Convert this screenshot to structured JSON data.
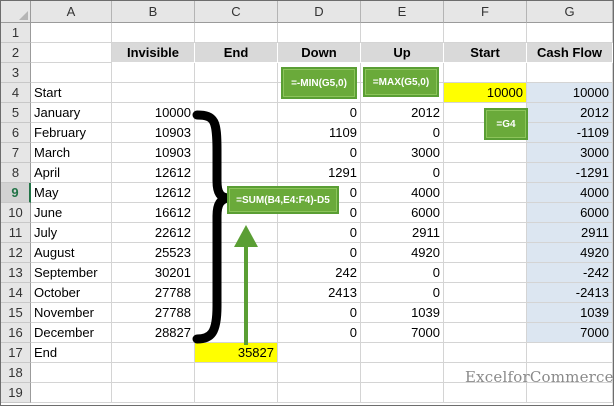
{
  "columns": [
    "A",
    "B",
    "C",
    "D",
    "E",
    "F",
    "G"
  ],
  "rows": [
    "1",
    "2",
    "3",
    "4",
    "5",
    "6",
    "7",
    "8",
    "9",
    "10",
    "11",
    "12",
    "13",
    "14",
    "15",
    "16",
    "17",
    "18",
    "19"
  ],
  "selected_row": "9",
  "headers": {
    "invisible": "Invisible",
    "end": "End",
    "down": "Down",
    "up": "Up",
    "start": "Start",
    "cash_flow": "Cash Flow"
  },
  "start_row": {
    "label": "Start",
    "start_value": "10000",
    "cash_flow": "10000"
  },
  "months": [
    {
      "month": "January",
      "invisible": "10000",
      "down": "0",
      "up": "2012",
      "cash_flow": "2012"
    },
    {
      "month": "February",
      "invisible": "10903",
      "down": "1109",
      "up": "0",
      "cash_flow": "-1109"
    },
    {
      "month": "March",
      "invisible": "10903",
      "down": "0",
      "up": "3000",
      "cash_flow": "3000"
    },
    {
      "month": "April",
      "invisible": "12612",
      "down": "1291",
      "up": "0",
      "cash_flow": "-1291"
    },
    {
      "month": "May",
      "invisible": "12612",
      "down": "0",
      "up": "4000",
      "cash_flow": "4000"
    },
    {
      "month": "June",
      "invisible": "16612",
      "down": "0",
      "up": "6000",
      "cash_flow": "6000"
    },
    {
      "month": "July",
      "invisible": "22612",
      "down": "0",
      "up": "2911",
      "cash_flow": "2911"
    },
    {
      "month": "August",
      "invisible": "25523",
      "down": "0",
      "up": "4920",
      "cash_flow": "4920"
    },
    {
      "month": "September",
      "invisible": "30201",
      "down": "242",
      "up": "0",
      "cash_flow": "-242"
    },
    {
      "month": "October",
      "invisible": "27788",
      "down": "2413",
      "up": "0",
      "cash_flow": "-2413"
    },
    {
      "month": "November",
      "invisible": "27788",
      "down": "0",
      "up": "1039",
      "cash_flow": "1039"
    },
    {
      "month": "December",
      "invisible": "28827",
      "down": "0",
      "up": "7000",
      "cash_flow": "7000"
    }
  ],
  "end_row": {
    "label": "End",
    "end_value": "35827"
  },
  "callouts": {
    "down_formula": "=-MIN(G5,0)",
    "up_formula": "=MAX(G5,0)",
    "start_formula": "=G4",
    "sum_formula": "=SUM(B4,E4:F4)-D5"
  },
  "watermark": "ExcelforCommerce",
  "colors": {
    "header_fill": "#d9d9d9",
    "cash_flow_fill": "#dce6f1",
    "highlight": "#ffff00",
    "callout_green": "#6aaa3a",
    "arrow_green": "#5a9e34"
  }
}
